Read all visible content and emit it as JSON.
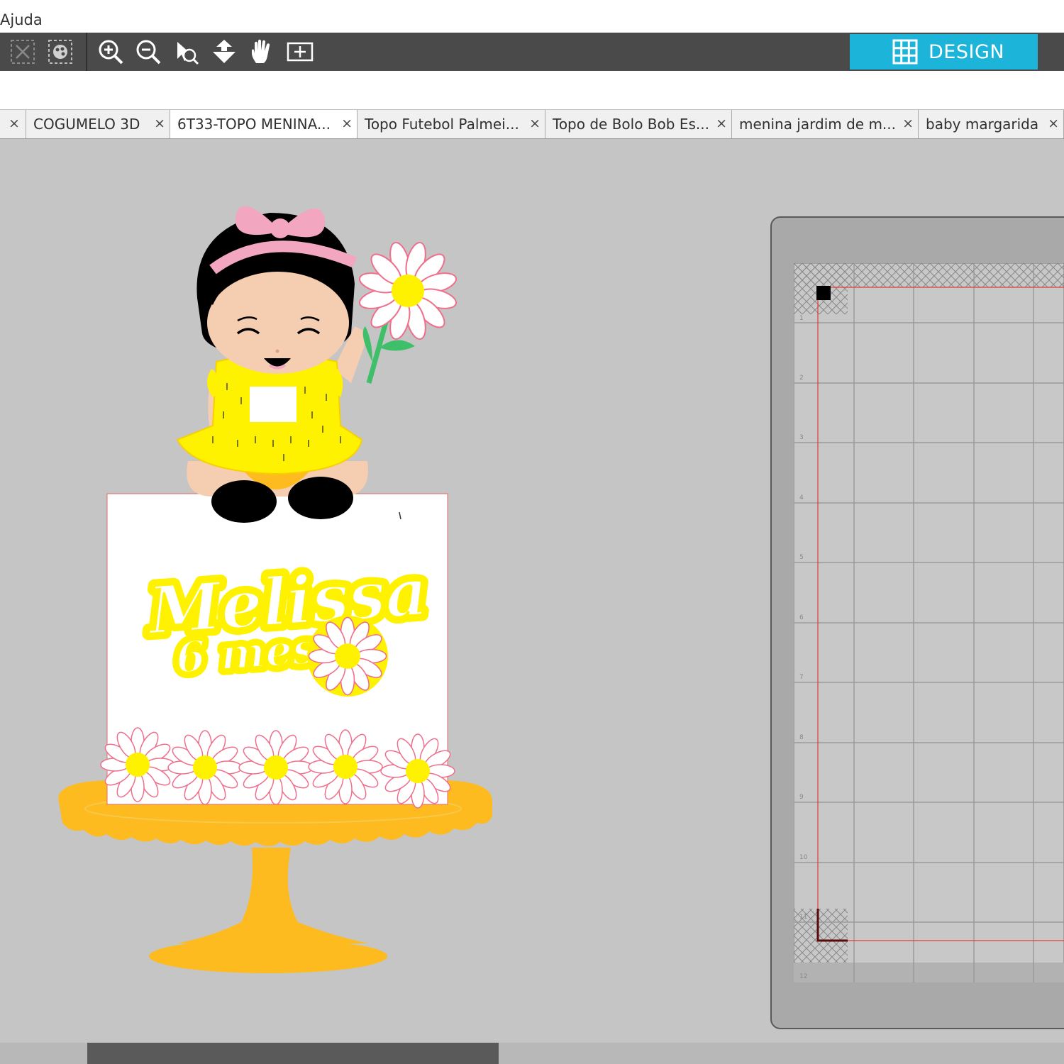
{
  "menu": {
    "help": "Ajuda"
  },
  "toolbar": {
    "tools": [
      {
        "icon": "deselect-icon"
      },
      {
        "icon": "select-all-icon"
      },
      {
        "icon": "zoom-in-icon"
      },
      {
        "icon": "zoom-out-icon"
      },
      {
        "icon": "zoom-selected-icon"
      },
      {
        "icon": "move-down-icon"
      },
      {
        "icon": "pan-hand-icon"
      },
      {
        "icon": "fit-to-page-icon"
      }
    ],
    "design_label": "DESIGN",
    "design_color": "#1cb4d8"
  },
  "tabs": [
    {
      "label": "COGUMELO 3D",
      "close": "×"
    },
    {
      "label": "6T33-TOPO MENINA...",
      "close": "×",
      "active": true
    },
    {
      "label": "Topo Futebol Palmei...",
      "close": "×"
    },
    {
      "label": "Topo de Bolo Bob Es...",
      "close": "×"
    },
    {
      "label": "menina jardim de m...",
      "close": "×"
    },
    {
      "label": "baby margarida",
      "close": "×"
    }
  ],
  "stray_close": "×",
  "artwork": {
    "name_text": "Melissa",
    "age_text": "6 meses",
    "colors": {
      "yellow": "#fff200",
      "orange": "#fdbb1f",
      "pink": "#f3a6c0",
      "skin": "#f5cdb0"
    }
  },
  "mat": {
    "ruler_numbers": [
      "1",
      "2",
      "3",
      "4",
      "5",
      "6",
      "7",
      "8",
      "9",
      "10",
      "11",
      "12"
    ]
  }
}
